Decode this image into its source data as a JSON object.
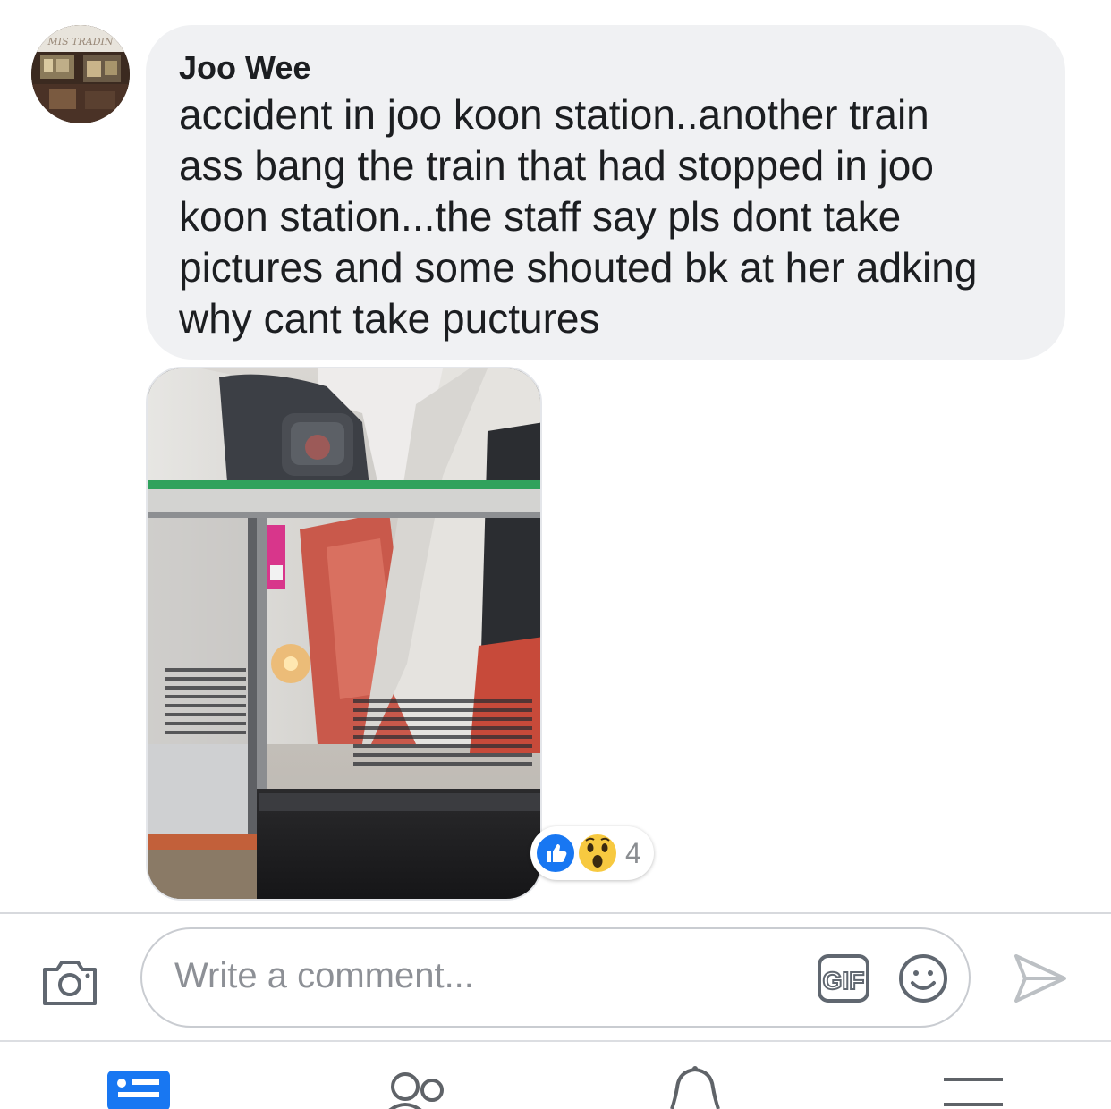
{
  "post": {
    "author": "Joo Wee",
    "avatar_text": "MIS TRADING",
    "comment_lines": [
      "accident in joo koon station..another train",
      "ass bang the train that had stopped in joo",
      "koon station...the staff say pls dont take",
      "pictures and some shouted bk at her adking",
      "why cant take puctures"
    ],
    "reactions": {
      "icons": [
        "like-icon",
        "wow-icon"
      ],
      "count": "4",
      "like_color": "#1877f2",
      "wow_color": "#f7c940"
    }
  },
  "composer": {
    "placeholder": "Write a comment...",
    "gif_label": "GIF"
  },
  "nav": {
    "items": [
      "news-feed-icon",
      "friends-icon",
      "notifications-icon",
      "menu-icon"
    ],
    "active_color": "#1877f2",
    "inactive_color": "#5f6368"
  }
}
